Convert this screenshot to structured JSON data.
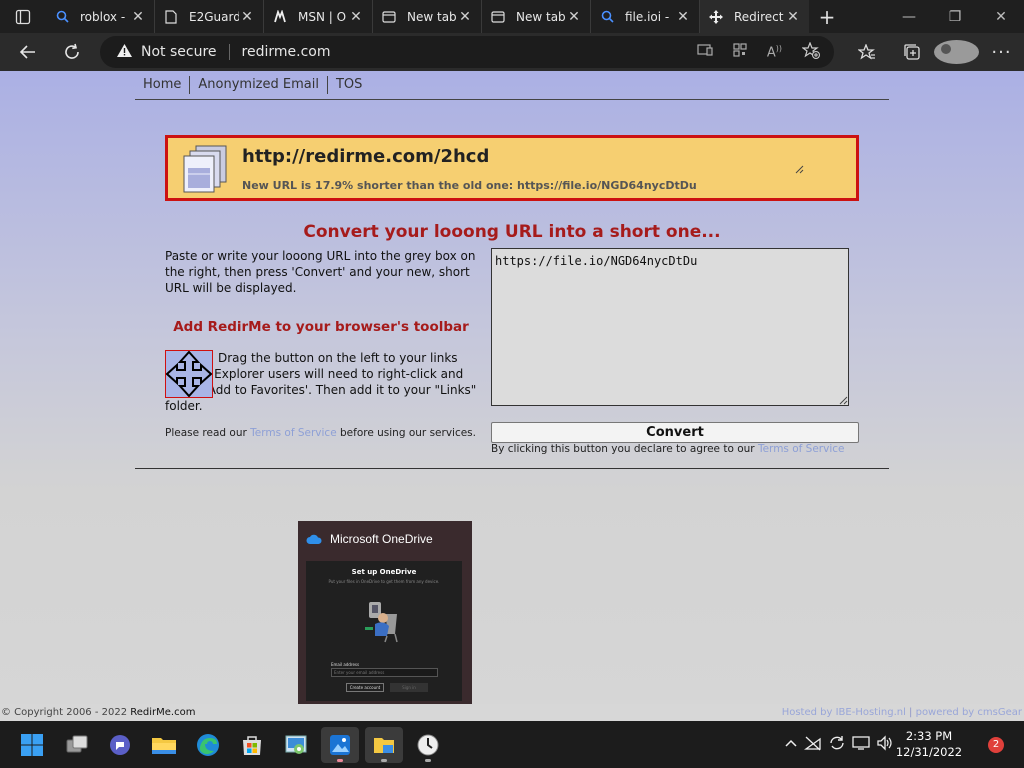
{
  "browser": {
    "tabs": [
      {
        "label": "roblox -",
        "icon": "search-icon"
      },
      {
        "label": "E2Guard",
        "icon": "page-icon"
      },
      {
        "label": "MSN | O",
        "icon": "msn-icon"
      },
      {
        "label": "New tab",
        "icon": "newtab-icon"
      },
      {
        "label": "New tab",
        "icon": "newtab-icon"
      },
      {
        "label": "file.ioi -",
        "icon": "search-icon"
      },
      {
        "label": "Redirect",
        "icon": "redirme-icon",
        "active": true
      }
    ],
    "security_label": "Not secure",
    "url": "redirme.com"
  },
  "site": {
    "nav": [
      "Home",
      "Anonymized Email",
      "TOS"
    ],
    "result": {
      "short_url": "http://redirme.com/2hcd",
      "info": "New URL is 17.9% shorter than the old one: https://file.io/NGD64nycDtDu"
    },
    "heading": "Convert your looong URL into a short one...",
    "description": "Paste or write your looong URL into the grey box on the right, then press 'Convert' and your new, short URL will be displayed.",
    "toolbar_heading": "Add RedirMe to your browser's toolbar",
    "drag_text": "Drag the button on the left to your links toolbar. Explorer users will need to right-click and select 'Add to Favorites'. Then add it to your \"Links\" folder.",
    "terms_note_prefix": "Please read our ",
    "terms_link": "Terms of Service",
    "terms_note_suffix": " before using our services.",
    "input_value": "https://file.io/NGD64nycDtDu",
    "convert_label": "Convert",
    "declare_prefix": "By clicking this button you declare to agree to our ",
    "declare_link": "Terms of Service",
    "footer_copyright_prefix": "© Copyright 2006 - 2022 ",
    "footer_copyright_site": "RedirMe.com",
    "footer_hosted": "Hosted by IBE-Hosting.nl",
    "footer_sep": " | ",
    "footer_powered": "powered by cmsGear"
  },
  "onedrive": {
    "title": "Microsoft OneDrive",
    "setup": "Set up OneDrive",
    "sub": "Put your files in OneDrive to get them from any device.",
    "email_label": "Email address",
    "email_placeholder": "Enter your email address",
    "create_label": "Create account",
    "signin_label": "Sign in"
  },
  "taskbar": {
    "time": "2:33 PM",
    "date": "12/31/2022",
    "notifications": "2"
  },
  "colors": {
    "accent_red": "#a61b1b",
    "result_bg": "#f6cf71",
    "result_border": "#cc1111",
    "link": "#8ea0d6"
  }
}
